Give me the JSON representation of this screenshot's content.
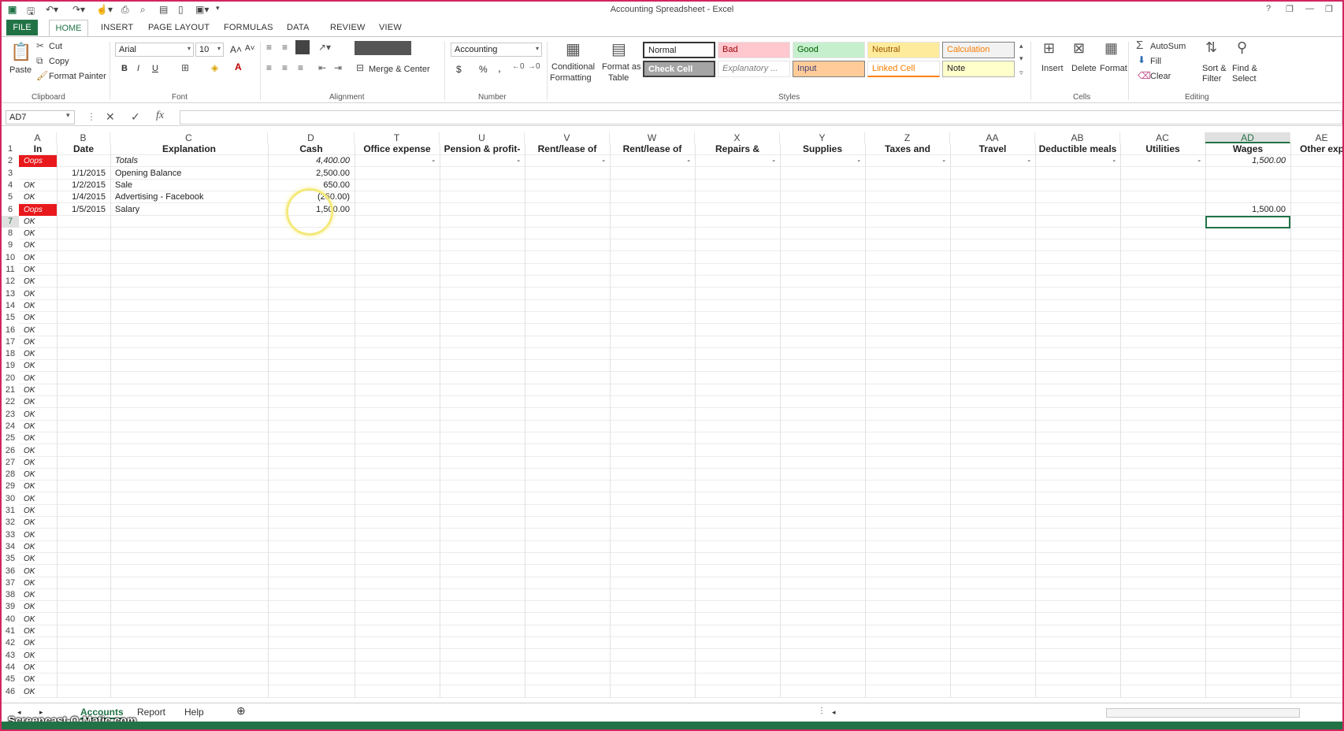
{
  "window": {
    "title": "Accounting Spreadsheet - Excel",
    "help": "?",
    "min": "—",
    "restore": "❐",
    "close": "✕"
  },
  "ribbon_tabs": [
    "FILE",
    "HOME",
    "INSERT",
    "PAGE LAYOUT",
    "FORMULAS",
    "DATA",
    "REVIEW",
    "VIEW"
  ],
  "clipboard": {
    "paste": "Paste",
    "cut": "Cut",
    "copy": "Copy",
    "format_painter": "Format Painter",
    "group": "Clipboard"
  },
  "font": {
    "name": "Arial",
    "size": "10",
    "group": "Font",
    "bold": "B",
    "italic": "I",
    "underline": "U"
  },
  "alignment": {
    "merge": "Merge & Center",
    "group": "Alignment"
  },
  "number": {
    "format": "Accounting",
    "group": "Number",
    "currency": "$",
    "percent": "%",
    "comma": ","
  },
  "styles": {
    "conditional": "Conditional",
    "conditional2": "Formatting",
    "format_as": "Format as",
    "format_as2": "Table",
    "group": "Styles",
    "cells": [
      {
        "label": "Normal"
      },
      {
        "label": "Bad"
      },
      {
        "label": "Good"
      },
      {
        "label": "Neutral"
      },
      {
        "label": "Calculation"
      },
      {
        "label": "Check Cell"
      },
      {
        "label": "Explanatory ..."
      },
      {
        "label": "Input"
      },
      {
        "label": "Linked Cell"
      },
      {
        "label": "Note"
      }
    ]
  },
  "cells_group": {
    "insert": "Insert",
    "delete": "Delete",
    "format": "Format",
    "group": "Cells"
  },
  "editing": {
    "autosum": "AutoSum",
    "fill": "Fill",
    "clear": "Clear",
    "sort": "Sort &",
    "sort2": "Filter",
    "find": "Find &",
    "find2": "Select",
    "group": "Editing"
  },
  "formula_bar": {
    "name_box": "AD7",
    "cancel": "✕",
    "enter": "✓",
    "fx": "fx",
    "value": ""
  },
  "columns": [
    "A",
    "B",
    "C",
    "D",
    "T",
    "U",
    "V",
    "W",
    "X",
    "Y",
    "Z",
    "AA",
    "AB",
    "AC",
    "AD",
    "AE"
  ],
  "headers": {
    "in": "In",
    "date": "Date",
    "explanation": "Explanation",
    "cash": "Cash",
    "t": "Office expense",
    "u": "Pension & profit-",
    "v": "Rent/lease of",
    "w": "Rent/lease of",
    "x": "Repairs &",
    "y": "Supplies",
    "z": "Taxes and",
    "aa": "Travel",
    "ab": "Deductible meals",
    "ac": "Utilities",
    "ad": "Wages",
    "ae": "Other exp"
  },
  "totals": {
    "flag": "Oops",
    "label": "Totals",
    "cash": "4,400.00",
    "dash": "-",
    "wages": "1,500.00"
  },
  "rows": [
    {
      "flag": "",
      "date": "1/1/2015",
      "explanation": "Opening Balance",
      "cash": "2,500.00",
      "wages": ""
    },
    {
      "flag": "OK",
      "date": "1/2/2015",
      "explanation": "Sale",
      "cash": "650.00",
      "wages": ""
    },
    {
      "flag": "OK",
      "date": "1/4/2015",
      "explanation": "Advertising - Facebook",
      "cash": "(250.00)",
      "wages": ""
    },
    {
      "flag": "Oops",
      "date": "1/5/2015",
      "explanation": "Salary",
      "cash": "1,500.00",
      "wages": "1,500.00"
    }
  ],
  "ok_label": "OK",
  "sheet_tabs": [
    "Accounts",
    "Report",
    "Help"
  ],
  "add_sheet": "⊕",
  "watermark": "Screencast-O-Matic.com"
}
